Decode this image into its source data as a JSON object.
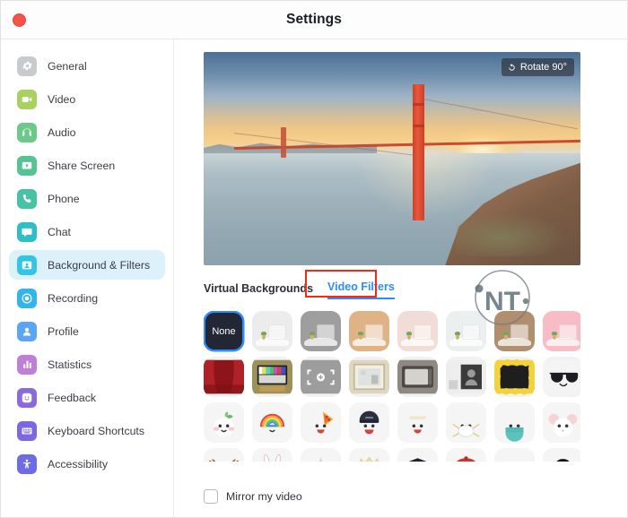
{
  "window": {
    "title": "Settings",
    "close_button": "close"
  },
  "sidebar": {
    "items": [
      {
        "label": "General",
        "icon": "gear-icon",
        "color": "#c9cacd",
        "active": false
      },
      {
        "label": "Video",
        "icon": "video-camera-icon",
        "color": "#a9d162",
        "active": false
      },
      {
        "label": "Audio",
        "icon": "headphones-icon",
        "color": "#6dc98a",
        "active": false
      },
      {
        "label": "Share Screen",
        "icon": "share-screen-icon",
        "color": "#55c492",
        "active": false
      },
      {
        "label": "Phone",
        "icon": "phone-icon",
        "color": "#47c2a4",
        "active": false
      },
      {
        "label": "Chat",
        "icon": "chat-bubble-icon",
        "color": "#2ebfc4",
        "active": false
      },
      {
        "label": "Background & Filters",
        "icon": "person-card-icon",
        "color": "#32c5e8",
        "active": true
      },
      {
        "label": "Recording",
        "icon": "record-icon",
        "color": "#34b4ef",
        "active": false
      },
      {
        "label": "Profile",
        "icon": "person-icon",
        "color": "#5aa6f5",
        "active": false
      },
      {
        "label": "Statistics",
        "icon": "bar-chart-icon",
        "color": "#b munch",
        "active": false
      },
      {
        "label": "Feedback",
        "icon": "smiley-icon",
        "color": "#8b6ae0",
        "active": false
      },
      {
        "label": "Keyboard Shortcuts",
        "icon": "keyboard-icon",
        "color": "#7d68e3",
        "active": false
      },
      {
        "label": "Accessibility",
        "icon": "accessibility-icon",
        "color": "#6e6be6",
        "active": false
      }
    ]
  },
  "preview": {
    "rotate_button_label": "Rotate 90°",
    "rotate_icon": "rotate-icon",
    "watermark_text": "NT",
    "scene": "golden-gate-bridge-sunset"
  },
  "tabs": [
    {
      "label": "Virtual Backgrounds",
      "active": false
    },
    {
      "label": "Video Filters",
      "active": true
    }
  ],
  "annotation": {
    "color": "#f42b10",
    "target": "Video Filters"
  },
  "filters": {
    "selected": "None",
    "none_label": "None",
    "rows": [
      {
        "tiles": [
          {
            "name": "none",
            "type": "none"
          },
          {
            "name": "tint-white",
            "type": "room",
            "color": "#ececec"
          },
          {
            "name": "tint-gray",
            "type": "room",
            "color": "#9e9e9e"
          },
          {
            "name": "tint-tan",
            "type": "room",
            "color": "#dfb386"
          },
          {
            "name": "tint-blush",
            "type": "room",
            "color": "#f2dcd8"
          },
          {
            "name": "tint-cool-white",
            "type": "room",
            "color": "#eceff0"
          },
          {
            "name": "tint-brown",
            "type": "room",
            "color": "#b08e6e"
          },
          {
            "name": "tint-pink",
            "type": "room",
            "color": "#f7bcc6"
          }
        ]
      },
      {
        "tiles": [
          {
            "name": "red-curtains",
            "type": "art",
            "color": "#9c1a1f"
          },
          {
            "name": "tv-test-card",
            "type": "art",
            "color": "#9d9159"
          },
          {
            "name": "focus-frame",
            "type": "art",
            "color": "#9b9b9b"
          },
          {
            "name": "picture-frame",
            "type": "art",
            "color": "#ddd6c2"
          },
          {
            "name": "old-tv",
            "type": "art",
            "color": "#8f8982"
          },
          {
            "name": "portrait-card",
            "type": "art",
            "color": "#e3e3e3"
          },
          {
            "name": "emoji-border",
            "type": "art",
            "color": "#f3d23b"
          },
          {
            "name": "sunglasses",
            "type": "art",
            "color": "#f4f4f4"
          }
        ]
      },
      {
        "tiles": [
          {
            "name": "sprout-face",
            "type": "face",
            "color": "#f5f5f5"
          },
          {
            "name": "rainbow-face",
            "type": "face",
            "color": "#f5f5f5"
          },
          {
            "name": "pizza-face",
            "type": "face",
            "color": "#f5f5f5"
          },
          {
            "name": "cap-face",
            "type": "face",
            "color": "#f5f5f5"
          },
          {
            "name": "plain-face",
            "type": "face",
            "color": "#f5f5f5"
          },
          {
            "name": "white-mask-face",
            "type": "face",
            "color": "#f5f5f5"
          },
          {
            "name": "teal-mask-face",
            "type": "face",
            "color": "#f5f5f5"
          },
          {
            "name": "mouse-face",
            "type": "face",
            "color": "#f5f5f5"
          }
        ]
      },
      {
        "tiles": [
          {
            "name": "antlers-face",
            "type": "face",
            "color": "#f5f5f5"
          },
          {
            "name": "bunny-ears-face",
            "type": "face",
            "color": "#f5f5f5"
          },
          {
            "name": "unicorn-face",
            "type": "face",
            "color": "#f5f5f5"
          },
          {
            "name": "crown-face",
            "type": "face",
            "color": "#f5f5f5"
          },
          {
            "name": "graduation-face",
            "type": "face",
            "color": "#f5f5f5"
          },
          {
            "name": "beret-face",
            "type": "face",
            "color": "#f5f5f5"
          },
          {
            "name": "mustache-face",
            "type": "face",
            "color": "#f5f5f5"
          },
          {
            "name": "black-hat-face",
            "type": "face",
            "color": "#f5f5f5"
          }
        ]
      }
    ]
  },
  "mirror": {
    "label": "Mirror my video",
    "checked": false
  }
}
